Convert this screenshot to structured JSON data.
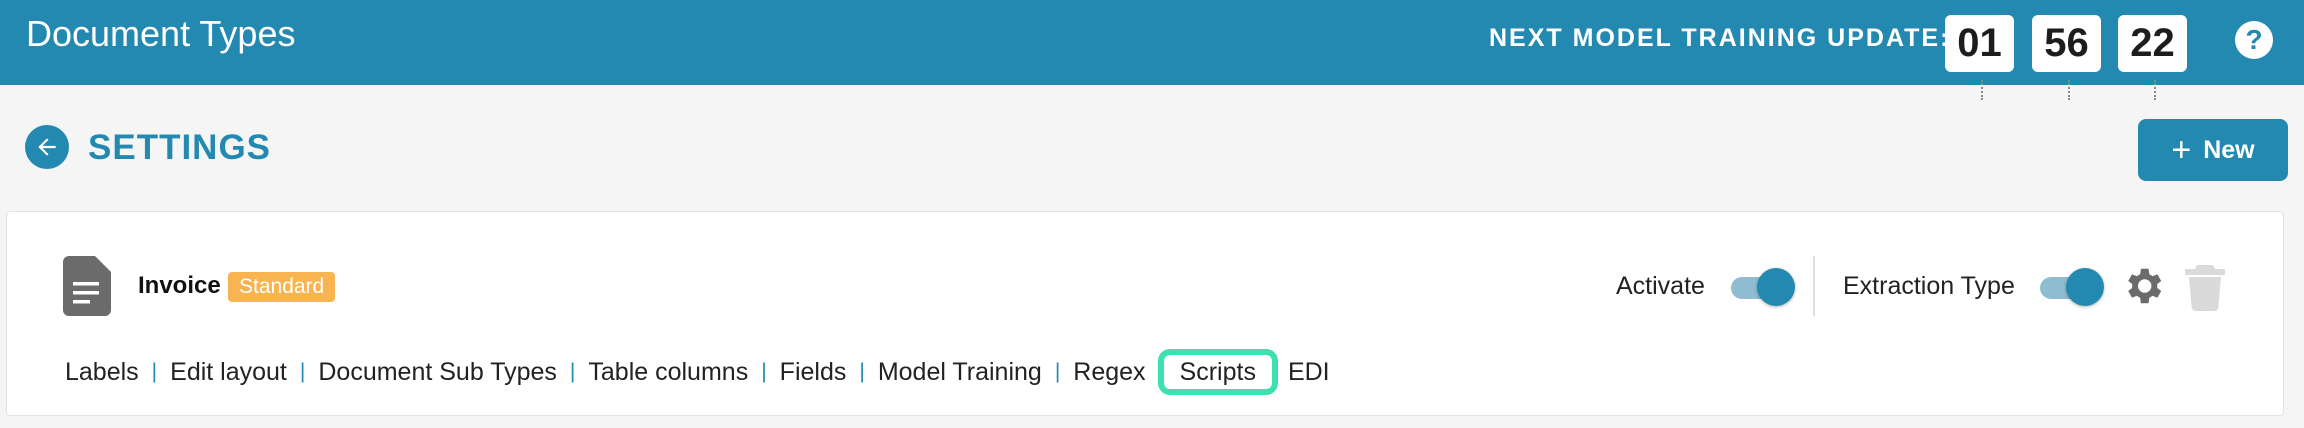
{
  "header": {
    "title": "Document Types",
    "timer_label": "NEXT MODEL TRAINING UPDATE:",
    "timer": {
      "hours": "01",
      "minutes": "56",
      "seconds": "22"
    },
    "help_icon": "?"
  },
  "page": {
    "back_icon": "arrow-left-icon",
    "title": "SETTINGS",
    "new_button": {
      "icon": "+",
      "label": "New"
    }
  },
  "document_type": {
    "icon": "document-icon",
    "name": "Invoice",
    "badge": "Standard",
    "activate_label": "Activate",
    "activate_on": true,
    "extraction_label": "Extraction Type",
    "extraction_on": true,
    "settings_icon": "gear-icon",
    "delete_icon": "trash-icon"
  },
  "tabs": [
    {
      "label": "Labels"
    },
    {
      "label": "Edit layout"
    },
    {
      "label": "Document Sub Types"
    },
    {
      "label": "Table columns"
    },
    {
      "label": "Fields"
    },
    {
      "label": "Model Training"
    },
    {
      "label": "Regex"
    },
    {
      "label": "Scripts"
    },
    {
      "label": "EDI"
    }
  ],
  "active_tab": "Scripts",
  "separator": "|",
  "colors": {
    "primary": "#2389b0",
    "badge": "#f7b451",
    "highlight": "#3ee0b0"
  }
}
